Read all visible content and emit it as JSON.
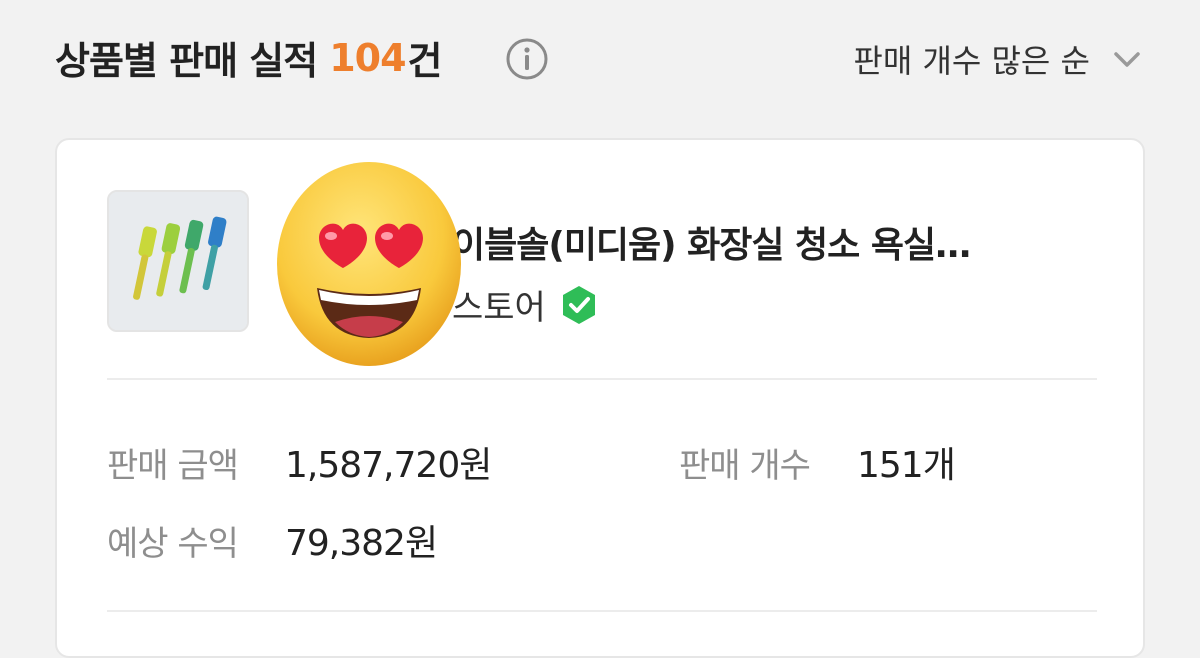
{
  "header": {
    "title": "상품별 판매 실적",
    "count": "104",
    "count_unit": "건",
    "info_icon": "info-icon",
    "sort_label": "판매 개수 많은 순",
    "sort_icon": "chevron-down-icon",
    "accent_color": "#ee7f2d"
  },
  "product": {
    "name": "이블솔(미디움) 화장실 청소 욕실…",
    "store": "스토어",
    "verified_icon": "verified-badge-icon",
    "overlay_emoji": "heart-eyes-emoji",
    "stats": {
      "sales_amount_label": "판매 금액",
      "sales_amount_value": "1,587,720원",
      "sales_count_label": "판매 개수",
      "sales_count_value": "151개",
      "expected_profit_label": "예상 수익",
      "expected_profit_value": "79,382원"
    }
  }
}
